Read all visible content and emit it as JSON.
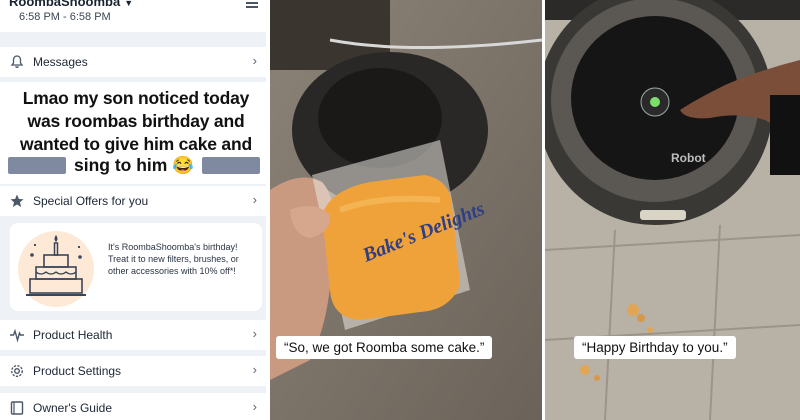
{
  "app": {
    "title": "RoombaShoomba",
    "schedule": "6:58 PM - 6:58 PM",
    "messages_label": "Messages",
    "caption": "Lmao my son noticed today was roombas birthday and wanted to give him cake and",
    "caption_tail": "sing to him 😂",
    "offers_label": "Special Offers for you",
    "offer_text": "It's RoombaShoomba's birthday! Treat it to new filters, brushes, or other accessories with 10% off*!",
    "menu": [
      {
        "label": "Product Health",
        "icon": "heartbeat-icon"
      },
      {
        "label": "Product Settings",
        "icon": "gear-icon"
      },
      {
        "label": "Owner's Guide",
        "icon": "book-icon"
      }
    ]
  },
  "photo_middle": {
    "subtitle": "“So, we got Roomba some cake.”",
    "cake_label": "Bake's Delights"
  },
  "photo_right": {
    "subtitle": "“Happy Birthday to you.”",
    "roomba_logo": "Robot"
  },
  "colors": {
    "accent": "#7f8aa0",
    "panel_bg": "#eef1f6",
    "cake_orange": "#f0a23a"
  }
}
